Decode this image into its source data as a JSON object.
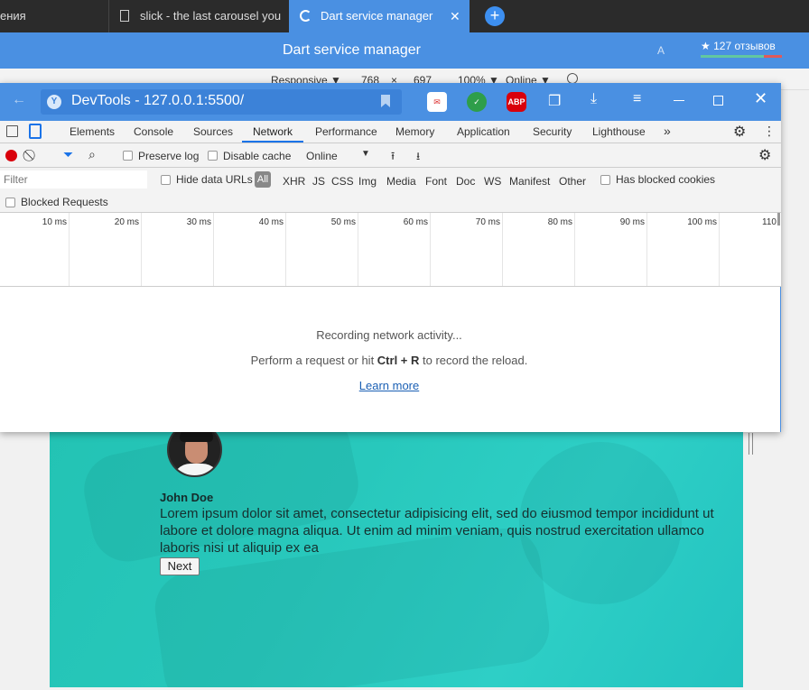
{
  "browser": {
    "tabs": [
      {
        "label": "ения"
      },
      {
        "label": "slick - the last carousel you"
      },
      {
        "label": "Dart service manager",
        "active": true
      }
    ],
    "new_tab": "+",
    "close": "✕"
  },
  "site": {
    "title": "Dart service manager",
    "reviews": "★ 127 отзывов",
    "translate_icon": "A"
  },
  "responsive": {
    "device": "Responsive ▼",
    "width": "768",
    "times": "×",
    "height": "697",
    "zoom": "100% ▼",
    "network": "Online ▼"
  },
  "devtools": {
    "title": "DevTools - 127.0.0.1:5500/",
    "favicon": "Y",
    "extensions": [
      {
        "label": "ABP",
        "color": "#d9000b"
      }
    ],
    "panels": [
      "Elements",
      "Console",
      "Sources",
      "Network",
      "Performance",
      "Memory",
      "Application",
      "Security",
      "Lighthouse"
    ],
    "more_panels": "»",
    "toolbar": {
      "preserve_log": "Preserve log",
      "disable_cache": "Disable cache",
      "throttle": "Online"
    },
    "filter": {
      "placeholder": "Filter",
      "hide_data_urls": "Hide data URLs",
      "all": "All",
      "types": [
        "XHR",
        "JS",
        "CSS",
        "Img",
        "Media",
        "Font",
        "Doc",
        "WS",
        "Manifest",
        "Other"
      ],
      "has_blocked_cookies": "Has blocked cookies",
      "blocked_requests": "Blocked Requests"
    },
    "timeline_ticks": [
      "10 ms",
      "20 ms",
      "30 ms",
      "40 ms",
      "50 ms",
      "60 ms",
      "70 ms",
      "80 ms",
      "90 ms",
      "100 ms",
      "110"
    ],
    "empty": {
      "title": "Recording network activity...",
      "sub_before": "Perform a request or hit ",
      "sub_key": "Ctrl + R",
      "sub_after": " to record the reload.",
      "learn_more": "Learn more"
    }
  },
  "testimonial": {
    "name": "John Doe",
    "quote": "Lorem ipsum dolor sit amet, consectetur adipisicing elit, sed do eiusmod tempor incididunt ut labore et dolore magna aliqua. Ut enim ad minim veniam, quis nostrud exercitation ullamco laboris nisi ut aliquip ex ea",
    "next": "Next"
  }
}
